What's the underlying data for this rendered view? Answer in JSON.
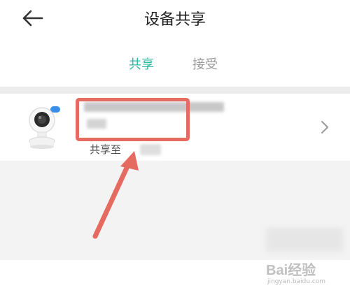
{
  "header": {
    "title": "设备共享",
    "back_icon": "arrow-left-icon"
  },
  "tabs": [
    {
      "label": "共享",
      "active": true
    },
    {
      "label": "接受",
      "active": false
    }
  ],
  "colors": {
    "accent": "#28b8a0",
    "annotation": "#e56b61",
    "inactive_tab": "#9a9a9a"
  },
  "device_card": {
    "share_prefix": "共享至",
    "device_icon": "camera-icon",
    "chevron_icon": "chevron-right-icon"
  },
  "watermark": {
    "brand": "Bai经验",
    "url": "jingyan.baidu.com"
  }
}
